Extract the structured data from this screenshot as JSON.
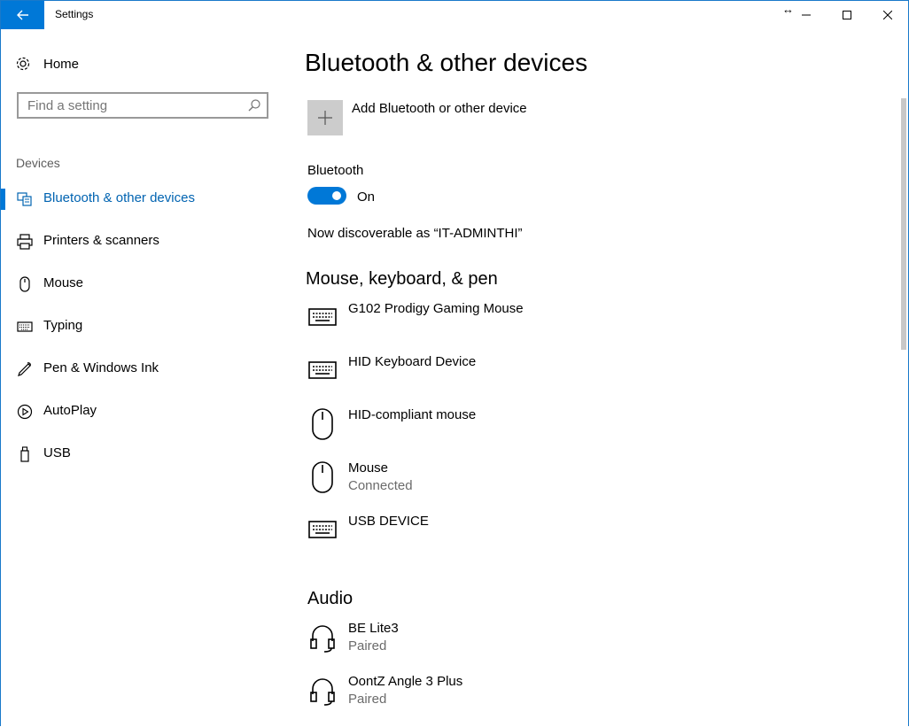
{
  "window": {
    "title": "Settings"
  },
  "sidebar": {
    "home_label": "Home",
    "search_placeholder": "Find a setting",
    "section_label": "Devices",
    "items": [
      {
        "label": "Bluetooth & other devices",
        "icon": "bluetooth-devices-icon",
        "active": true
      },
      {
        "label": "Printers & scanners",
        "icon": "printer-icon",
        "active": false
      },
      {
        "label": "Mouse",
        "icon": "mouse-icon",
        "active": false
      },
      {
        "label": "Typing",
        "icon": "keyboard-icon",
        "active": false
      },
      {
        "label": "Pen & Windows Ink",
        "icon": "pen-icon",
        "active": false
      },
      {
        "label": "AutoPlay",
        "icon": "autoplay-icon",
        "active": false
      },
      {
        "label": "USB",
        "icon": "usb-icon",
        "active": false
      }
    ]
  },
  "main": {
    "title": "Bluetooth & other devices",
    "add_device_label": "Add Bluetooth or other device",
    "bluetooth_label": "Bluetooth",
    "bluetooth_state": "On",
    "discoverable_text": "Now discoverable as “IT-ADMINTHI”",
    "sections": [
      {
        "title": "Mouse, keyboard, & pen",
        "devices": [
          {
            "name": "G102 Prodigy Gaming Mouse",
            "status": "",
            "icon": "keyboard-icon"
          },
          {
            "name": "HID Keyboard Device",
            "status": "",
            "icon": "keyboard-icon"
          },
          {
            "name": "HID-compliant mouse",
            "status": "",
            "icon": "mouse-icon"
          },
          {
            "name": "Mouse",
            "status": "Connected",
            "icon": "mouse-icon"
          },
          {
            "name": "USB DEVICE",
            "status": "",
            "icon": "keyboard-icon"
          }
        ]
      },
      {
        "title": "Audio",
        "devices": [
          {
            "name": "BE Lite3",
            "status": "Paired",
            "icon": "headset-icon"
          },
          {
            "name": "OontZ Angle 3 Plus",
            "status": "Paired",
            "icon": "headset-icon"
          }
        ]
      }
    ]
  },
  "colors": {
    "accent": "#0078d7",
    "active_text": "#0063b1",
    "secondary_text": "#6b6b6b"
  }
}
